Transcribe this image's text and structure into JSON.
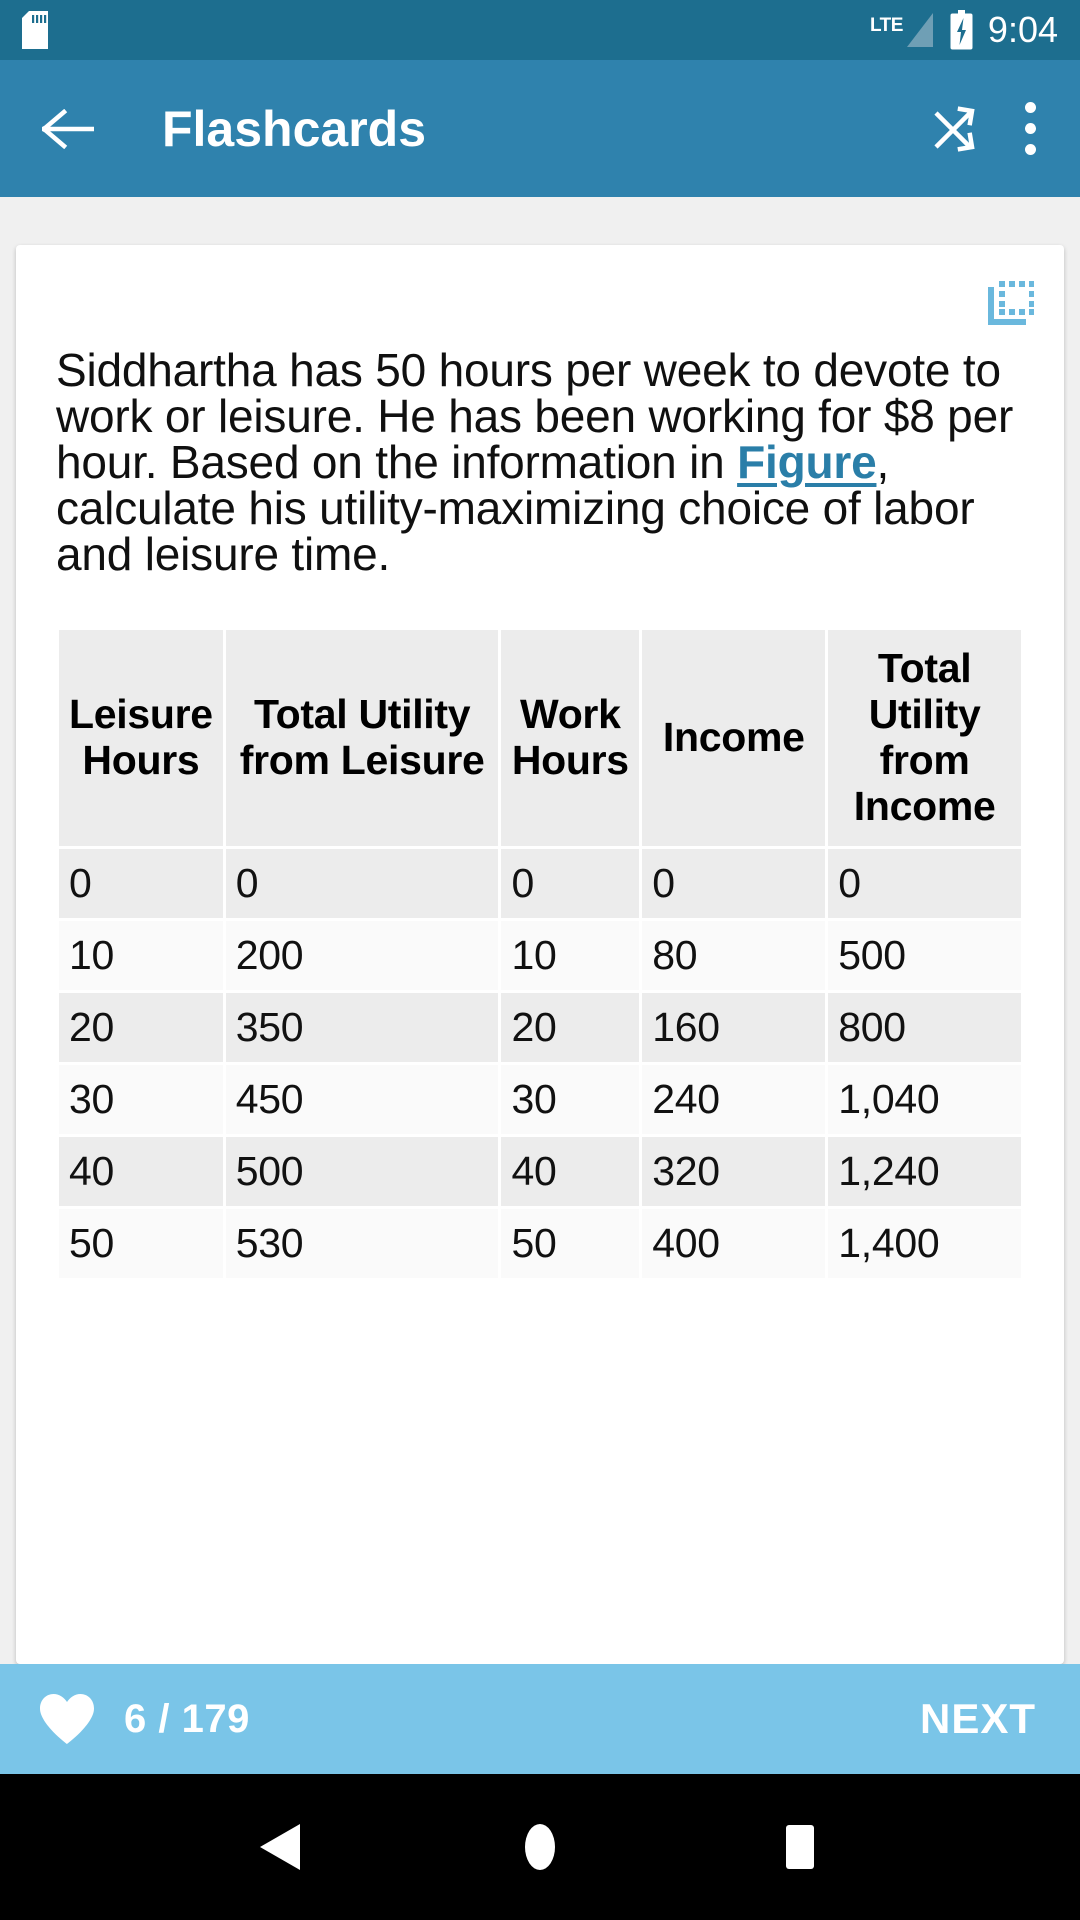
{
  "status_bar": {
    "sd_card_icon": "sd-card-icon",
    "network_label": "LTE",
    "signal_icon": "signal-bars-icon",
    "battery_icon": "battery-charging-icon",
    "time": "9:04",
    "background_color": "#1d6e8f"
  },
  "app_bar": {
    "back_icon": "arrow-back-icon",
    "title": "Flashcards",
    "shuffle_icon": "shuffle-icon",
    "overflow_icon": "overflow-menu-icon",
    "background_color": "#2f82ad"
  },
  "card": {
    "copy_icon": "select-all-copy-icon",
    "copy_icon_color": "#6ab8dd",
    "question": {
      "part1": "Siddhartha has 50 hours per week to devote to work or leisure. He has been working for $8 per hour. Based on the information in ",
      "link_text": "Figure",
      "part2": ", calculate his utility-maximizing choice of labor and leisure time.",
      "link_color": "#2a7ea8"
    },
    "table": {
      "headers": [
        "Leisure Hours",
        "Total Utility from Leisure",
        "Work Hours",
        "Income",
        "Total Utility from Income"
      ],
      "rows": [
        [
          "0",
          "0",
          "0",
          "0",
          "0"
        ],
        [
          "10",
          "200",
          "10",
          "80",
          "500"
        ],
        [
          "20",
          "350",
          "20",
          "160",
          "800"
        ],
        [
          "30",
          "450",
          "30",
          "240",
          "1,040"
        ],
        [
          "40",
          "500",
          "40",
          "320",
          "1,240"
        ],
        [
          "50",
          "530",
          "50",
          "400",
          "1,400"
        ]
      ],
      "header_background": "#ececec",
      "row_odd_background": "#ececec",
      "row_even_background": "#fafafa"
    }
  },
  "footer": {
    "favorite_icon": "heart-icon",
    "progress": "6 / 179",
    "next_label": "NEXT",
    "background_color": "#7ac5e8"
  },
  "nav_bar": {
    "back_icon": "nav-back-triangle-icon",
    "home_icon": "nav-home-circle-icon",
    "recents_icon": "nav-recents-square-icon",
    "background_color": "#000000"
  }
}
